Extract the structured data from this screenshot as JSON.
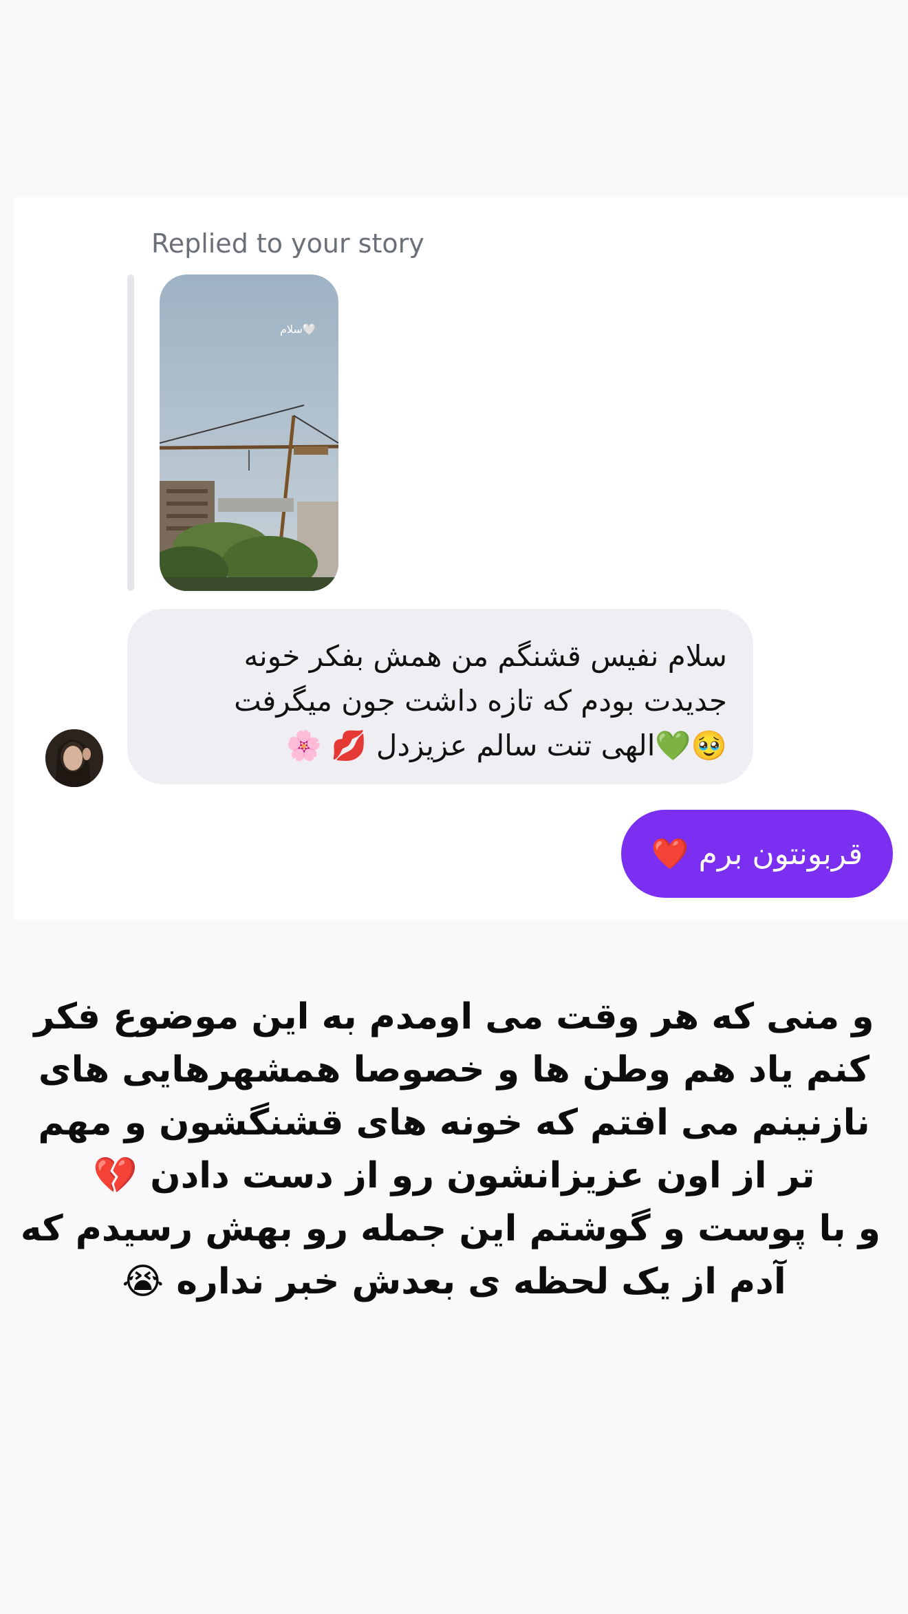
{
  "story_reply": {
    "label": "Replied to your story",
    "story_caption": "سلام🤍"
  },
  "messages": [
    {
      "direction": "incoming",
      "lines": [
        "سلام نفیس قشنگم من همش بفکر خونه",
        "جدیدت بودم که تازه داشت جون میگرفت",
        "🥹💚الهی تنت سالم عزیزدل 💋 🌸"
      ]
    },
    {
      "direction": "outgoing",
      "text": "قربونتون برم ❤️"
    }
  ],
  "colors": {
    "outgoing_bubble": "#7b2ff0",
    "incoming_bubble": "#efeff3",
    "background": "#f9f9fb"
  },
  "caption": {
    "lines": [
      "و منی که هر وقت می اومدم به این موضوع فکر",
      "کنم یاد هم وطن ها و خصوصا همشهرهایی های",
      "نازنینم می افتم که خونه های قشنگشون و مهم",
      "تر از اون عزیزانشون رو از دست دادن 💔",
      "و با پوست و گوشتم این جمله رو بهش رسیدم که",
      "آدم از یک لحظه ی بعدش خبر نداره 😭"
    ]
  }
}
